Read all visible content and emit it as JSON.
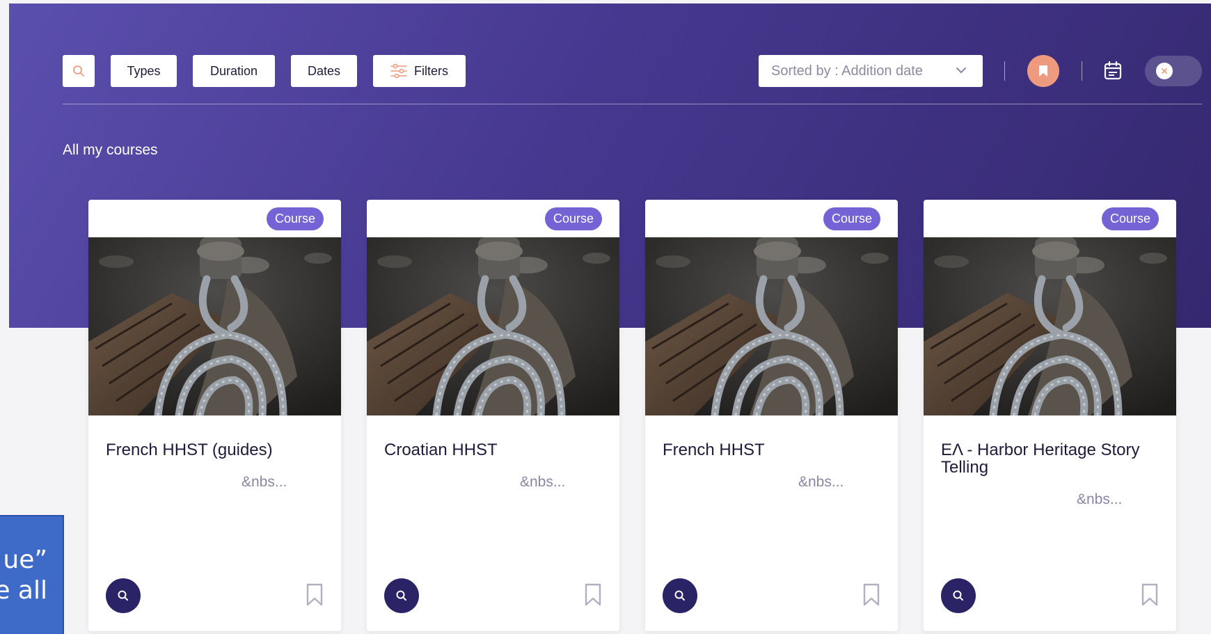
{
  "toolbar": {
    "search_icon": "search-icon",
    "types_label": "Types",
    "duration_label": "Duration",
    "dates_label": "Dates",
    "filters_label": "Filters",
    "filters_icon": "sliders-icon"
  },
  "sort": {
    "label": "Sorted by : Addition date",
    "icon": "chevron-down-icon"
  },
  "view_controls": {
    "bookmark_icon": "bookmark-icon",
    "calendar_icon": "calendar-icon",
    "toggle_icon": "close-icon"
  },
  "section": {
    "title": "All my courses"
  },
  "courses": [
    {
      "badge": "Course",
      "title": "French HHST (guides)",
      "excerpt": "&nbs..."
    },
    {
      "badge": "Course",
      "title": "Croatian HHST",
      "excerpt": "&nbs..."
    },
    {
      "badge": "Course",
      "title": "French HHST",
      "excerpt": "&nbs..."
    },
    {
      "badge": "Course",
      "title": "ΕΛ - Harbor Heritage Story Telling",
      "excerpt": "&nbs..."
    }
  ],
  "overlay_tooltip": {
    "line1": "ue”",
    "line2": "ee all"
  },
  "colors": {
    "hero_start": "#5b4fae",
    "hero_end": "#35286f",
    "badge": "#7463d4",
    "accent_orange": "#ee9a7f",
    "dark_button": "#2a2366",
    "tooltip_blue": "#3f6bc8"
  }
}
